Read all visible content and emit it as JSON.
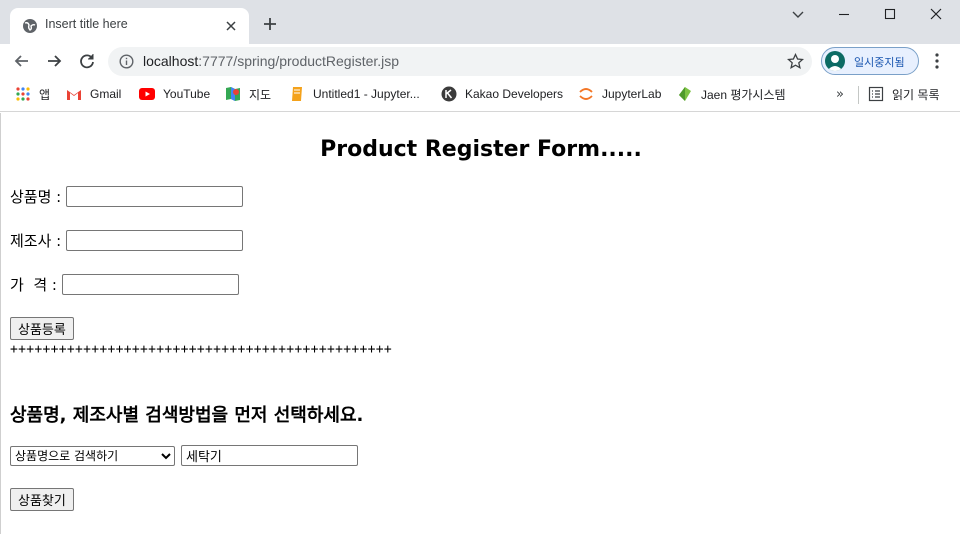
{
  "browser": {
    "tab_title": "Insert title here",
    "url_host": "localhost",
    "url_path": ":7777/spring/productRegister.jsp",
    "profile_label": "일시중지됨",
    "bookmarks": [
      {
        "label": "앱",
        "icon": "apps-grid-icon"
      },
      {
        "label": "Gmail",
        "icon": "gmail-icon"
      },
      {
        "label": "YouTube",
        "icon": "youtube-icon"
      },
      {
        "label": "지도",
        "icon": "maps-icon"
      },
      {
        "label": "Untitled1 - Jupyter...",
        "icon": "jupyter-notebook-icon"
      },
      {
        "label": "Kakao Developers",
        "icon": "kakao-developers-icon"
      },
      {
        "label": "JupyterLab",
        "icon": "jupyterlab-icon"
      },
      {
        "label": "Jaen 평가시스템",
        "icon": "jaen-icon"
      }
    ],
    "reading_list_label": "읽기 목록",
    "more_bookmarks": "»"
  },
  "form": {
    "title": "Product Register Form.....",
    "name_label": "상품명 : ",
    "maker_label": "제조사 : ",
    "price_label": "가  격 : ",
    "name_value": "",
    "maker_value": "",
    "price_value": "",
    "register_button": "상품등록"
  },
  "separator": "+++++++++++++++++++++++++++++++++++++++++++++++",
  "search": {
    "heading": "상품명, 제조사별 검색방법을 먼저 선택하세요.",
    "type_selected": "상품명으로 검색하기",
    "keyword_value": "세탁기",
    "find_button": "상품찾기"
  },
  "colors": {
    "tabstrip": "#dee1e6",
    "omnibox": "#f1f3f4",
    "profile_text": "#1a56b0"
  }
}
